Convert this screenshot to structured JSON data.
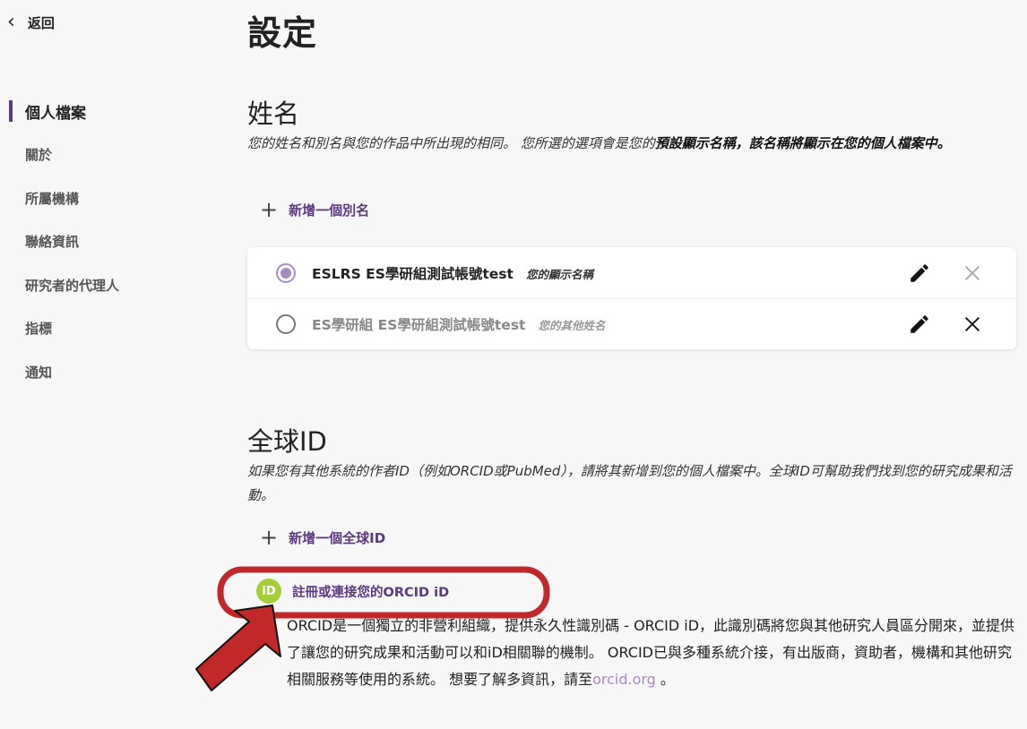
{
  "back": {
    "label": "返回"
  },
  "sidebar": {
    "items": [
      {
        "label": "個人檔案"
      },
      {
        "label": "關於"
      },
      {
        "label": "所屬機構"
      },
      {
        "label": "聯絡資訊"
      },
      {
        "label": "研究者的代理人"
      },
      {
        "label": "指標"
      },
      {
        "label": "通知"
      }
    ]
  },
  "page": {
    "title": "設定"
  },
  "names": {
    "title": "姓名",
    "desc_part1": "您的姓名和別名與您的作品中所出現的相同。 您所選的選項會是您的",
    "desc_bold": "預設顯示名稱，該名稱將顯示在您的個人檔案中。",
    "add_label": "新增一個別名",
    "rows": [
      {
        "name": "ESLRS ES學研組測試帳號test",
        "tag": "您的顯示名稱"
      },
      {
        "name": "ES學研組 ES學研組測試帳號test",
        "tag": "您的其他姓名"
      }
    ]
  },
  "global_id": {
    "title": "全球ID",
    "desc": "如果您有其他系統的作者ID（例如ORCID或PubMed），請將其新增到您的個人檔案中。全球ID可幫助我們找到您的研究成果和活動。",
    "add_label": "新增一個全球ID"
  },
  "orcid": {
    "logo_text": "iD",
    "link_label": "註冊或連接您的ORCID iD",
    "desc": "ORCID是一個獨立的非營利組織，提供永久性識別碼 - ORCID iD，此識別碼將您與其他研究人員區分開來，並提供了讓您的研究成果和活動可以和iD相關聯的機制。 ORCID已與多種系統介接，有出版商，資助者，機構和其他研究相關服務等使用的系統。 想要了解多資訊，請至",
    "site_link": "orcid.org",
    "desc_end": " 。"
  },
  "colors": {
    "accent": "#5c3a7e",
    "radio_selected": "#a98bc4",
    "orcid_green": "#a6ce39",
    "annotation_red": "#c0282a"
  }
}
